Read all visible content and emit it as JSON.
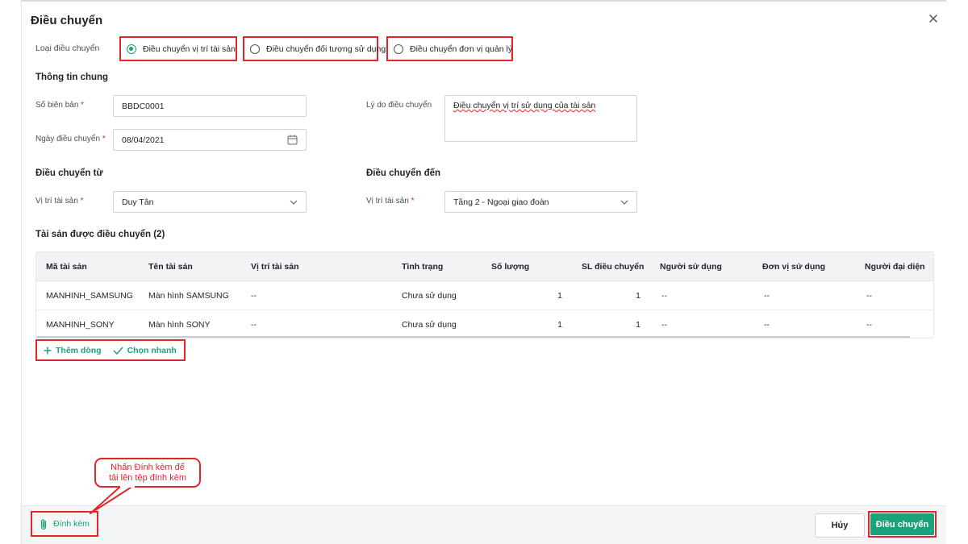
{
  "dialog": {
    "title": "Điều chuyển"
  },
  "transfer_type": {
    "label": "Loại điều chuyển",
    "options": [
      {
        "label": "Điều chuyển vị trí tài sản",
        "checked": true
      },
      {
        "label": "Điều chuyển đối tượng sử dụng",
        "checked": false
      },
      {
        "label": "Điều chuyển đơn vị quản lý",
        "checked": false
      }
    ]
  },
  "general": {
    "title": "Thông tin chung",
    "record_no": {
      "label": "Số biên bản",
      "value": "BBDC0001"
    },
    "date": {
      "label": "Ngày điều chuyển",
      "value": "08/04/2021"
    },
    "reason": {
      "label": "Lý do điều chuyển",
      "value": "Điều chuyển vị trí sử dụng của tài sản"
    }
  },
  "from": {
    "title": "Điều chuyển từ",
    "location_label": "Vị trí tài sản",
    "location_value": "Duy Tân"
  },
  "to": {
    "title": "Điều chuyển đến",
    "location_label": "Vị trí tài sản",
    "location_value": "Tầng 2 - Ngoại giao đoàn"
  },
  "assets": {
    "title": "Tài sản được điều chuyển (2)",
    "columns": [
      "Mã tài sản",
      "Tên tài sản",
      "Vị trí tài sản",
      "Tình trạng",
      "Số lượng",
      "SL điều chuyển",
      "Người sử dụng",
      "Đơn vị sử dụng",
      "Người đại diện"
    ],
    "rows": [
      [
        "MANHINH_SAMSUNG",
        "Màn hình SAMSUNG",
        "--",
        "Chưa sử dụng",
        "1",
        "1",
        "--",
        "--",
        "--"
      ],
      [
        "MANHINH_SONY",
        "Màn hình SONY",
        "--",
        "Chưa sử dụng",
        "1",
        "1",
        "--",
        "--",
        "--"
      ]
    ],
    "add_row_label": "Thêm dòng",
    "quick_pick_label": "Chọn nhanh"
  },
  "callout": {
    "line1": "Nhấn Đính kèm để",
    "line2": "tải lên tệp đính kèm"
  },
  "footer": {
    "attach_label": "Đính kèm",
    "cancel_label": "Hủy",
    "submit_label": "Điều chuyển"
  },
  "colors": {
    "accent": "#1aa37a",
    "highlight": "#e0262b",
    "footer_bg": "#f4f5f7"
  }
}
